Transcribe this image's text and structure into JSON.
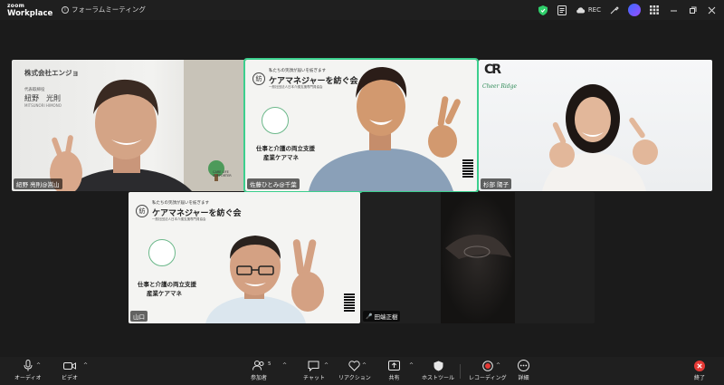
{
  "app": {
    "logo_line1": "zoom",
    "logo_line2": "Workplace",
    "meeting_title": "フォーラムミーティング"
  },
  "titlebar": {
    "rec_label": "REC"
  },
  "participants": [
    {
      "name": "紐野 亮則@嵩山",
      "company": "株式会社エンジョ",
      "role": "代表取締役",
      "person_name": "紐野　光則",
      "person_name_en": "MITSUNORI HIMONO",
      "tree_label": "CARE LIFE SUPPORTER"
    },
    {
      "name": "佐藤ひとみ@千葉",
      "banner_top": "私たちの笑顔が届いを紡ぎます",
      "banner_main": "ケアマネジャーを紡ぐ会",
      "banner_sub": "一般社団法人日本介護支援専門員協会",
      "tag1": "仕事と介護の両立支援",
      "tag2": "産業ケアマネ",
      "logo_char": "紡"
    },
    {
      "name": "杉部 陽子",
      "brand": "Cheer Ridge",
      "brand_mark": "CR"
    },
    {
      "name": "山口",
      "banner_top": "私たちの笑顔が届いを紡ぎます",
      "banner_main": "ケアマネジャーを紡ぐ会",
      "banner_sub": "一般社団法人日本介護支援専門員協会",
      "tag1": "仕事と介護の両立支援",
      "tag2": "産業ケアマネ",
      "logo_char": "紡"
    },
    {
      "name": "田端正樹",
      "muted": true
    }
  ],
  "toolbar": {
    "audio": "オーディオ",
    "video": "ビデオ",
    "participants": "参加者",
    "participants_count": "5",
    "chat": "チャット",
    "reactions": "リアクション",
    "share": "共有",
    "host_tools": "ホストツール",
    "recording": "レコーディング",
    "more": "詳細",
    "end": "終了"
  },
  "colors": {
    "active_speaker": "#3ccf8e",
    "end_red": "#e53935",
    "rec_red": "#e53935",
    "shield_green": "#2fcf6b"
  }
}
